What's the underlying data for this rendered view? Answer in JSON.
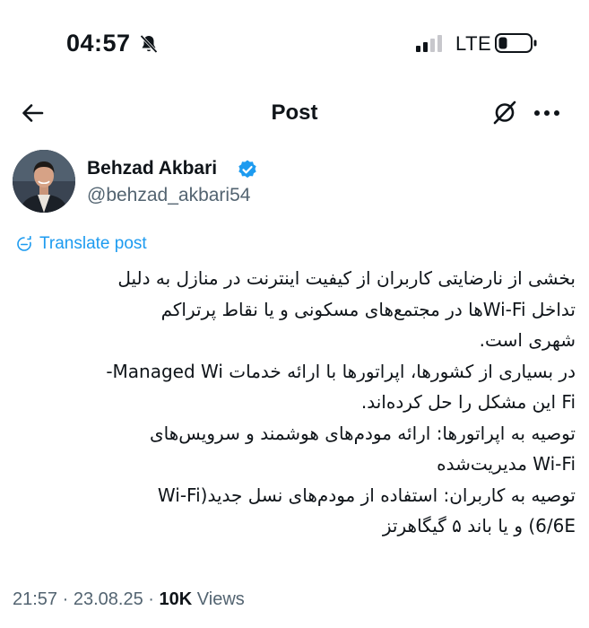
{
  "status_bar": {
    "time": "04:57",
    "network": "LTE"
  },
  "nav": {
    "title": "Post",
    "icons": [
      "back-arrow-icon",
      "grok-icon",
      "more-icon"
    ]
  },
  "author": {
    "name": "Behzad Akbari",
    "handle": "@behzad_akbari54",
    "verified": true
  },
  "translate_label": "Translate post",
  "post": {
    "lines": [
      "بخشی از نارضایتی کاربران از کیفیت اینترنت در منازل به دلیل",
      "تداخل Wi-Fiها در مجتمع‌های مسکونی و یا نقاط پرتراکم",
      "شهری است.",
      "در بسیاری از کشورها، اپراتورها با ارائه خدمات Managed Wi-",
      "Fi این مشکل را حل کرده‌اند.",
      "توصیه به اپراتورها: ارائه مودم‌های هوشمند و سرویس‌های",
      "Wi-Fi مدیریت‌شده",
      "توصیه به کاربران: استفاده از مودم‌های نسل جدید(Wi-Fi",
      "6/6E) و یا باند ۵ گیگاهرتز"
    ]
  },
  "meta": {
    "time": "21:57",
    "date": "23.08.25",
    "views_count": "10K",
    "views_label": "Views",
    "separator": "·"
  },
  "colors": {
    "accent": "#1d9bf0",
    "text": "#0f1419",
    "secondary": "#536471"
  }
}
